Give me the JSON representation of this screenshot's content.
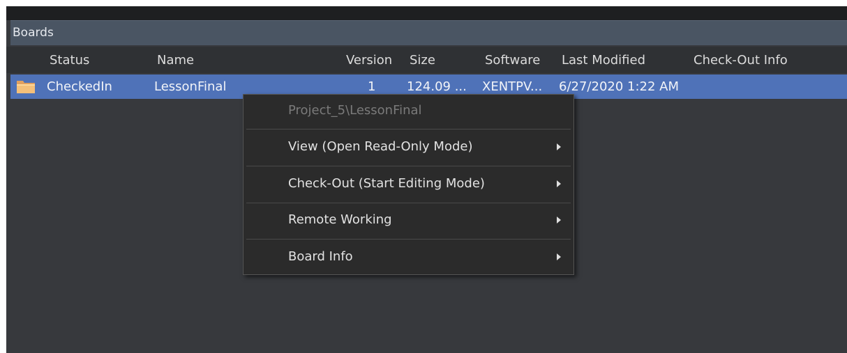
{
  "panel": {
    "title": "Boards"
  },
  "columns": {
    "status": "Status",
    "name": "Name",
    "version": "Version",
    "size": "Size",
    "software": "Software",
    "last_modified": "Last Modified",
    "checkout_info": "Check-Out Info"
  },
  "rows": [
    {
      "icon": "folder-icon",
      "status": "CheckedIn",
      "name": "LessonFinal",
      "version": "1",
      "size": "124.09 ...",
      "software": "XENTPV...",
      "last_modified": "6/27/2020 1:22 AM",
      "checkout_info": ""
    }
  ],
  "context_menu": {
    "path": "Project_5\\LessonFinal",
    "items": [
      {
        "label": "View (Open Read-Only Mode)"
      },
      {
        "label": "Check-Out (Start Editing Mode)"
      },
      {
        "label": "Remote Working"
      },
      {
        "label": "Board Info"
      }
    ]
  },
  "colors": {
    "background": "#37393d",
    "header": "#4a5563",
    "selected_row": "#4f72b8",
    "menu": "#2b2b2b"
  }
}
